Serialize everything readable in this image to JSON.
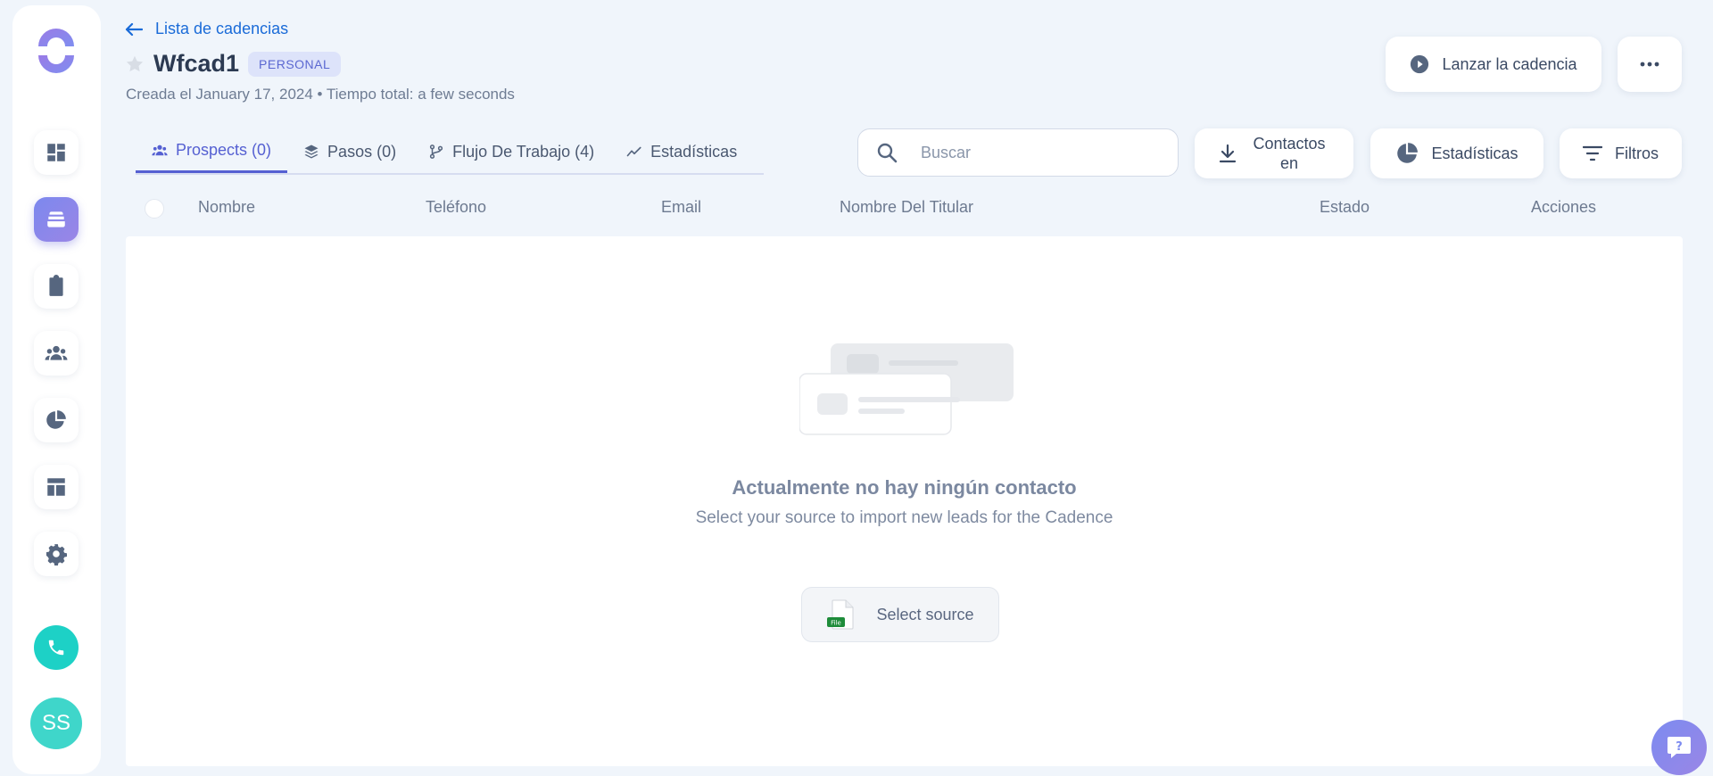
{
  "sidebar": {
    "items": [
      {
        "name": "dashboard",
        "icon": "dashboard-icon"
      },
      {
        "name": "cadences",
        "icon": "stack-icon",
        "active": true
      },
      {
        "name": "tasks",
        "icon": "clipboard-list-icon"
      },
      {
        "name": "people",
        "icon": "people-icon"
      },
      {
        "name": "statistics",
        "icon": "pie-chart-icon"
      },
      {
        "name": "templates",
        "icon": "layout-icon"
      },
      {
        "name": "settings",
        "icon": "gear-icon"
      }
    ],
    "avatar_initials": "SS"
  },
  "header": {
    "back_label": "Lista de cadencias",
    "title": "Wfcad1",
    "badge": "PERSONAL",
    "subtitle": "Creada el January 17, 2024 • Tiempo total: a few seconds",
    "launch_label": "Lanzar la cadencia"
  },
  "tabs": [
    {
      "label": "Prospects (0)",
      "icon": "people-icon",
      "active": true
    },
    {
      "label": "Pasos (0)",
      "icon": "layers-icon"
    },
    {
      "label": "Flujo De Trabajo (4)",
      "icon": "workflow-icon"
    },
    {
      "label": "Estadísticas",
      "icon": "trend-line-icon"
    }
  ],
  "toolbar": {
    "search_placeholder": "Buscar",
    "import_label": "Contactos en",
    "stats_label": "Estadísticas",
    "filters_label": "Filtros"
  },
  "table": {
    "columns": [
      "Nombre",
      "Teléfono",
      "Email",
      "Nombre Del Titular",
      "Estado",
      "Acciones"
    ]
  },
  "empty": {
    "title": "Actualmente no hay ningún contacto",
    "subtitle": "Select your source to import new leads for the Cadence",
    "source_label": "Select source",
    "file_badge": "File"
  },
  "colors": {
    "accent": "#5560d2",
    "link": "#1a6bd8",
    "teal": "#1dd1c6",
    "background": "#f0f5fb"
  }
}
